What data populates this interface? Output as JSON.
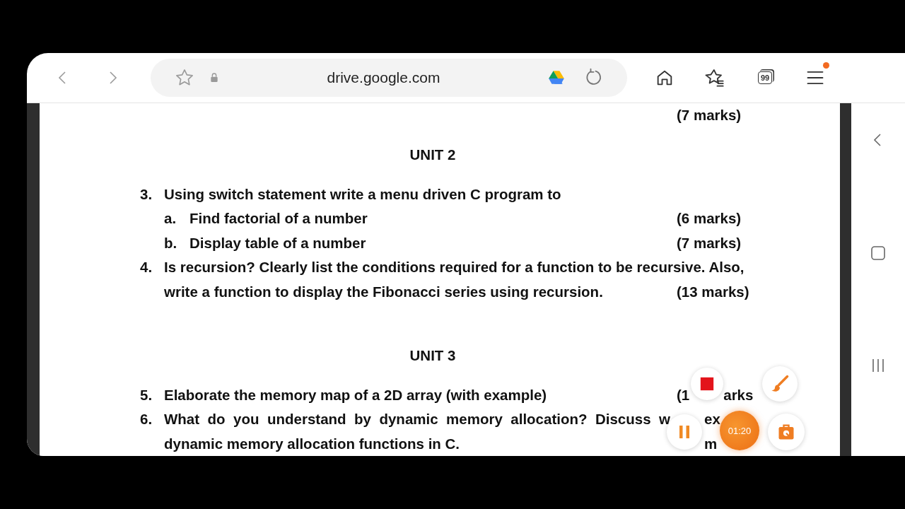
{
  "browser": {
    "url": "drive.google.com",
    "tab_count": "99",
    "menu_badge": true
  },
  "document": {
    "lines": [
      {
        "kind": "marks",
        "marks": [
          "(7 marks)"
        ]
      },
      {
        "kind": "heading",
        "text": "UNIT 2"
      },
      {
        "kind": "question",
        "number": "3.",
        "text": "Using switch statement write a menu driven C program to"
      },
      {
        "kind": "sub",
        "number": "a.",
        "text": "Find factorial of a number",
        "marks": [
          "(6 marks)"
        ]
      },
      {
        "kind": "sub",
        "number": "b.",
        "text": "Display table of a number",
        "marks": [
          "(7 marks)"
        ]
      },
      {
        "kind": "question",
        "number": "4.",
        "text": "Is recursion? Clearly list the conditions required for a function to be recursive. Also,"
      },
      {
        "kind": "continuation",
        "text": "write a function to display the Fibonacci series using recursion.",
        "marks": [
          "(13 marks)"
        ]
      },
      {
        "kind": "heading",
        "text": "UNIT 3"
      },
      {
        "kind": "question",
        "number": "5.",
        "text": "Elaborate the memory map of a 2D array (with example)",
        "marks": [
          "(1",
          "arks"
        ]
      },
      {
        "kind": "question",
        "number": "6.",
        "text": "What do you understand by dynamic memory allocation? Discuss w",
        "marks": [
          "ex"
        ],
        "justify": true
      },
      {
        "kind": "continuation",
        "text": "dynamic memory allocation functions in C.",
        "marks": [
          "m"
        ]
      }
    ]
  },
  "recorder": {
    "timer": "01:20"
  }
}
